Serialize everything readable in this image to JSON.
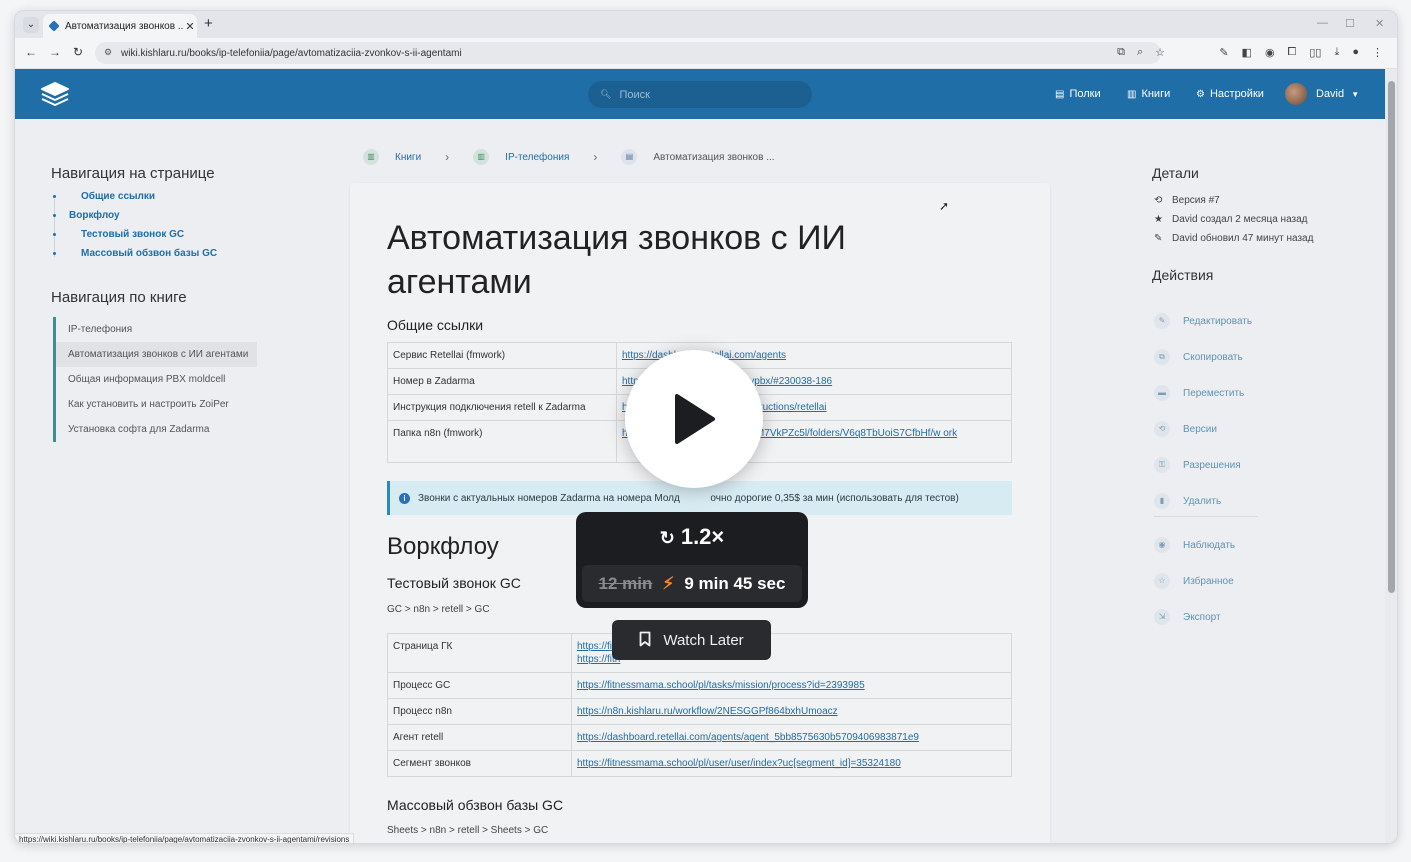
{
  "browser": {
    "tab_title": "Автоматизация звонков ... | W",
    "url": "wiki.kishlaru.ru/books/ip-telefoniia/page/avtomatizaciia-zvonkov-s-ii-agentami",
    "status_url": "https://wiki.kishlaru.ru/books/ip-telefoniia/page/avtomatizaciia-zvonkov-s-ii-agentami/revisions"
  },
  "header": {
    "search_placeholder": "Поиск",
    "nav": [
      {
        "label": "Полки"
      },
      {
        "label": "Книги"
      },
      {
        "label": "Настройки"
      }
    ],
    "user": "David"
  },
  "left": {
    "page_nav_title": "Навигация на странице",
    "page_nav": [
      "Общие ссылки",
      "Воркфлоу",
      "Тестовый звонок GC",
      "Массовый обзвон базы GC"
    ],
    "book_nav_title": "Навигация по книге",
    "book_nav": [
      "IP-телефония",
      "Автоматизация звонков с ИИ агентами",
      "Общая информация PBX moldcell",
      "Как установить и настроить ZoiPer",
      "Установка софта для Zadarma"
    ]
  },
  "breadcrumbs": [
    "Книги",
    "IP-телефония",
    "Автоматизация звонков ..."
  ],
  "content": {
    "title": "Автоматизация звонков с ИИ агентами",
    "section1": "Общие ссылки",
    "links_table": [
      [
        "Сервис Retellai (fmwork)",
        "https://dashboard.retellai.com/agents"
      ],
      [
        "Номер в Zadarma",
        "https://m                                vpbx/#230038-186"
      ],
      [
        "Инструкция подключения retell к Zadarma",
        "https://                               t/instructions/retellai"
      ],
      [
        "Папка n8n (fmwork)",
        "http                              4TtMg9M7VkPZc5l/folders/V6q8TbUoiS7CfbHf/w ork"
      ]
    ],
    "callout": "Звонки с актуальных номеров Zadarma на номера Молд           очно дорогие 0,35$ за мин (использовать для тестов)",
    "section2": "Воркфлоу",
    "sub1": "Тестовый звонок GC",
    "flow1": "GC > n8n > retell > GC",
    "gc_table": [
      [
        "Страница ГК",
        "https://fitn                            pr?id=4456711",
        "https://fitn"
      ],
      [
        "Процесс GC",
        "https://fitnessmama.school/pl/tasks/mission/process?id=2393985",
        ""
      ],
      [
        "Процесс n8n",
        "https://n8n.kishlaru.ru/workflow/2NESGGPf864bxhUmoacz",
        ""
      ],
      [
        "Агент retell",
        "https://dashboard.retellai.com/agents/agent_5bb8575630b5709406983871e9",
        ""
      ],
      [
        "Сегмент звонков",
        "https://fitnessmama.school/pl/user/user/index?uc[segment_id]=35324180",
        ""
      ]
    ],
    "sub2": "Массовый обзвон базы GC",
    "flow2": "Sheets > n8n > retell > Sheets > GC"
  },
  "right": {
    "details_title": "Детали",
    "details": [
      "Версия #7",
      "David создал 2 месяца назад",
      "David обновил 47 минут назад"
    ],
    "actions_title": "Действия",
    "actions": [
      "Редактировать",
      "Скопировать",
      "Переместить",
      "Версии",
      "Разрешения",
      "Удалить"
    ],
    "actions2": [
      "Наблюдать",
      "Избранное",
      "Экспорт"
    ]
  },
  "overlay": {
    "speed": "1.2×",
    "old_time": "12 min",
    "new_time": "9 min 45 sec",
    "watch_later": "Watch Later"
  }
}
